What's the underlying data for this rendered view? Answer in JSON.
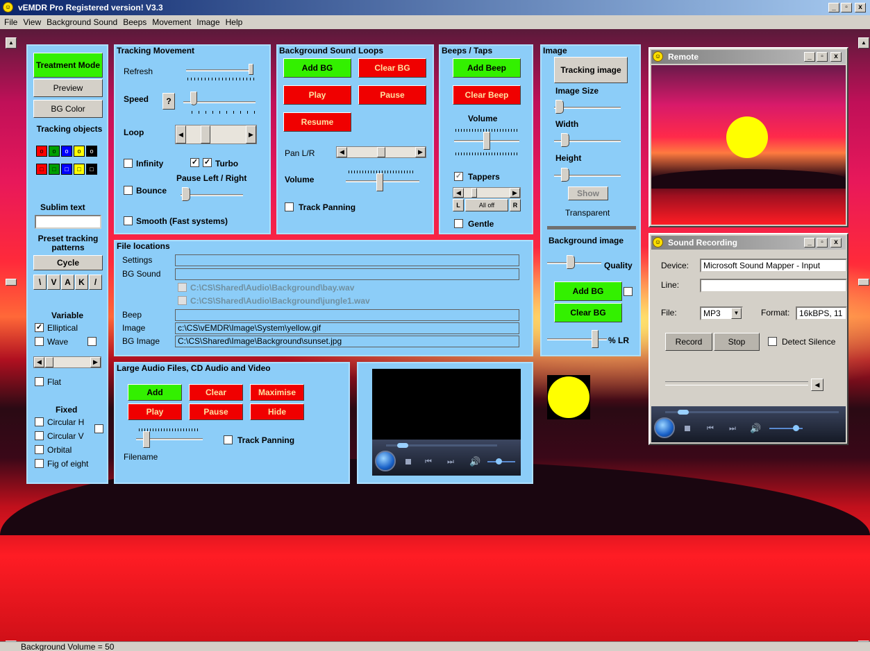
{
  "window": {
    "title": "vEMDR Pro Registered version! V3.3",
    "min": "_",
    "max": "▫",
    "close": "x",
    "smiley": "☺"
  },
  "menu": [
    "File",
    "View",
    "Background Sound",
    "Beeps",
    "Movement",
    "Image",
    "Help"
  ],
  "status": "Background Volume = 50",
  "left": {
    "treatment_mode": "Treatment Mode",
    "preview": "Preview",
    "bg_color": "BG Color",
    "tracking_objects": "Tracking objects",
    "obj_top": [
      "o",
      "o",
      "o",
      "o",
      "o"
    ],
    "obj_bottom": [
      "□",
      "□",
      "□",
      "□",
      "□"
    ],
    "sublim_text": "Sublim text",
    "preset": "Preset tracking patterns",
    "cycle": "Cycle",
    "patterns": [
      "\\",
      "V",
      "A",
      "K",
      "/"
    ],
    "variable": "Variable",
    "elliptical": "Elliptical",
    "wave": "Wave",
    "flat": "Flat",
    "fixed": "Fixed",
    "circ_h": "Circular H",
    "circ_v": "Circular V",
    "orbital": "Orbital",
    "fig8": "Fig of eight",
    "colors": {
      "obj": [
        "#ff0000",
        "#00a000",
        "#0000ff",
        "#ffff00",
        "#000000"
      ]
    }
  },
  "tracking": {
    "title": "Tracking Movement",
    "refresh": "Refresh",
    "speed": "Speed",
    "speed_help": "?",
    "loop": "Loop",
    "infinity": "Infinity",
    "turbo": "Turbo",
    "pause_lr": "Pause Left / Right",
    "bounce": "Bounce",
    "smooth": "Smooth (Fast systems)"
  },
  "bgsound": {
    "title": "Background Sound Loops",
    "add_bg": "Add BG",
    "clear_bg": "Clear BG",
    "play": "Play",
    "pause": "Pause",
    "resume": "Resume",
    "pan": "Pan L/R",
    "volume": "Volume",
    "track_panning": "Track Panning"
  },
  "beeps": {
    "title": "Beeps / Taps",
    "add_beep": "Add Beep",
    "clear_beep": "Clear Beep",
    "volume": "Volume",
    "tappers": "Tappers",
    "all_off": "All off",
    "l": "L",
    "r": "R",
    "gentle": "Gentle"
  },
  "image": {
    "title": "Image",
    "tracking_image": "Tracking image",
    "image_size": "Image Size",
    "width": "Width",
    "height": "Height",
    "show": "Show",
    "transparent": "Transparent",
    "bg_image": "Background image",
    "quality": "Quality",
    "add_bg": "Add BG",
    "clear_bg": "Clear BG",
    "pct_lr": "% LR"
  },
  "files": {
    "title": "File locations",
    "settings": "Settings",
    "bg_sound": "BG Sound",
    "bg_file1": "C:\\CS\\Shared\\Audio\\Background\\bay.wav",
    "bg_file2": "C:\\CS\\Shared\\Audio\\Background\\jungle1.wav",
    "beep": "Beep",
    "image": "Image",
    "image_path": "c:\\CS\\vEMDR\\Image\\System\\yellow.gif",
    "bg_image": "BG Image",
    "bg_image_path": "C:\\CS\\Shared\\Image\\Background\\sunset.jpg"
  },
  "large": {
    "title": "Large Audio Files, CD Audio and Video",
    "add": "Add",
    "clear": "Clear",
    "maximise": "Maximise",
    "play": "Play",
    "pause": "Pause",
    "hide": "Hide",
    "track_panning": "Track Panning",
    "filename": "Filename"
  },
  "remote": {
    "title": "Remote"
  },
  "recording": {
    "title": "Sound Recording",
    "device_label": "Device:",
    "device": "Microsoft Sound Mapper - Input",
    "line_label": "Line:",
    "line": "",
    "file_label": "File:",
    "file_type": "MP3",
    "format_label": "Format:",
    "format": "16kBPS, 11",
    "record": "Record",
    "stop": "Stop",
    "detect_silence": "Detect Silence"
  }
}
